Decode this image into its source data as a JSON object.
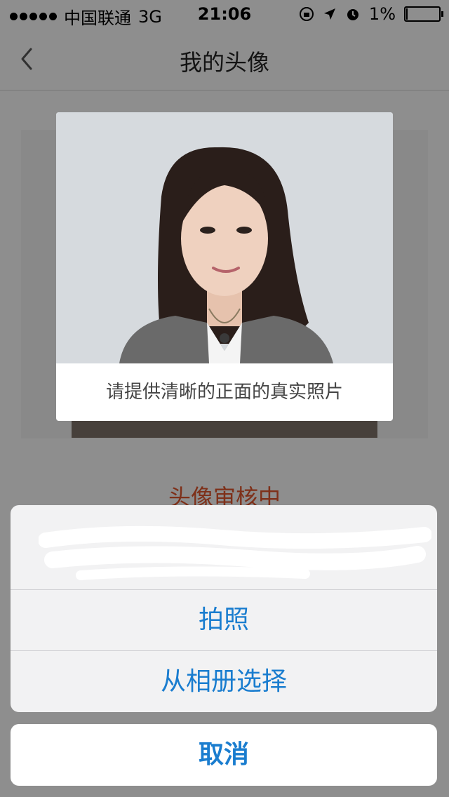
{
  "status_bar": {
    "carrier": "中国联通",
    "network": "3G",
    "time": "21:06",
    "battery": "1%"
  },
  "nav": {
    "title": "我的头像"
  },
  "profile": {
    "review_status": "头像审核中"
  },
  "sample_popup": {
    "caption": "请提供清晰的正面的真实照片"
  },
  "action_sheet": {
    "take_photo": "拍照",
    "choose_from_album": "从相册选择",
    "cancel": "取消"
  },
  "colors": {
    "accent": "#1a7dcf",
    "status_text": "#d9532c"
  }
}
